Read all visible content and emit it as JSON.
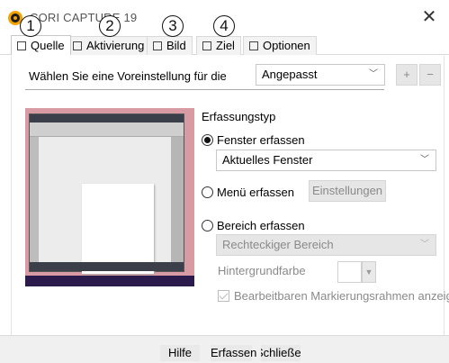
{
  "window": {
    "title": "CORI CAPTURE 19",
    "close_glyph": "✕"
  },
  "callouts": [
    "1",
    "2",
    "3",
    "4"
  ],
  "tabs": [
    {
      "label": "Quelle",
      "icon": "source-icon",
      "active": true
    },
    {
      "label": "Aktivierung",
      "icon": "activation-icon",
      "active": false
    },
    {
      "label": "Bild",
      "icon": "image-icon",
      "active": false
    },
    {
      "label": "Ziel",
      "icon": "destination-icon",
      "active": false
    },
    {
      "label": "Optionen",
      "icon": "options-icon",
      "active": false
    }
  ],
  "preset": {
    "label": "Wählen Sie eine Voreinstellung für die",
    "value": "Angepasst",
    "add": "+",
    "remove": "−"
  },
  "capture": {
    "heading": "Erfassungstyp",
    "window_option": "Fenster erfassen",
    "window_select": "Aktuelles Fenster",
    "menu_option": "Menü erfassen",
    "settings_button": "Einstellungen",
    "region_option": "Bereich erfassen",
    "region_select": "Rechteckiger Bereich",
    "background_label": "Hintergrundfarbe",
    "editable_frame": "Bearbeitbaren Markierungsrahmen anzeigen",
    "selected": "window"
  },
  "footer": {
    "help": "Hilfe",
    "capture": "Erfassen",
    "close": "Schließen"
  },
  "colors": {
    "accent": "#f2a300",
    "preview_bg": "#d89aa3",
    "disabled": "#8a8a8a"
  }
}
